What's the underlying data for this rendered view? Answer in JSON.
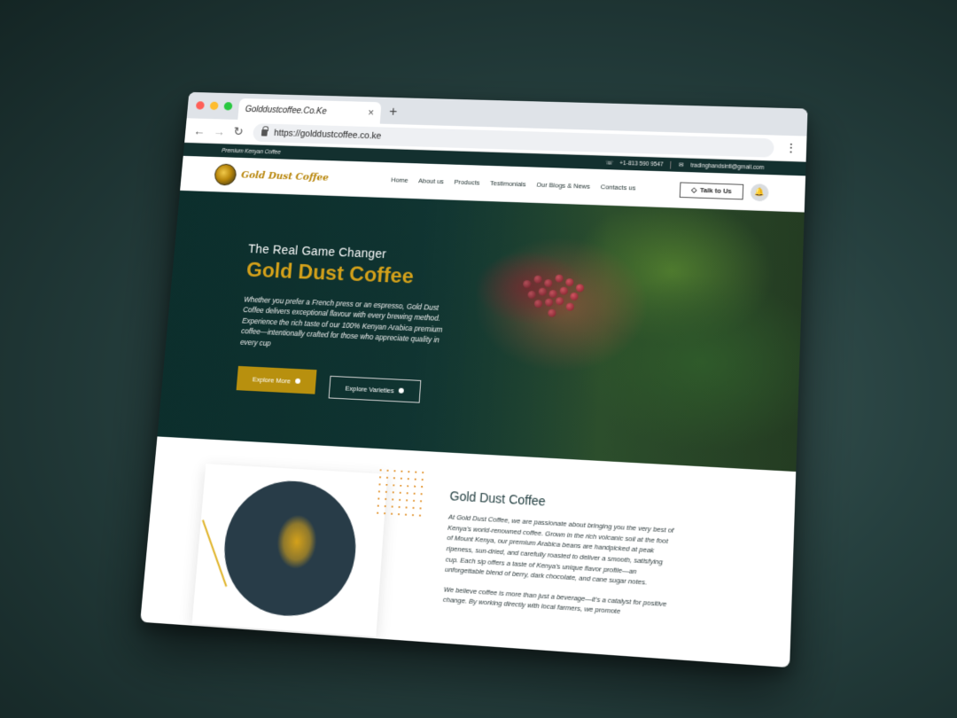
{
  "browser": {
    "tab_title": "Golddustcoffee.Co.Ke",
    "tab_close": "×",
    "new_tab": "+",
    "url": "https://golddustcoffee.co.ke",
    "back": "←",
    "forward": "→",
    "reload": "↻",
    "menu": "⋮"
  },
  "topbar": {
    "tagline": "Premium Kenyan Coffee",
    "phone": "+1-813 590 9547",
    "email": "tradinghandsintl@gmail.com"
  },
  "site_nav": {
    "logo_text": "Gold Dust Coffee",
    "menu": [
      "Home",
      "About us",
      "Products",
      "Testimonials",
      "Our Blogs & News",
      "Contacts us"
    ],
    "talk_button": "Talk to Us",
    "bell_icon": "🔔"
  },
  "hero": {
    "kicker": "The Real Game Changer",
    "title": "Gold Dust Coffee",
    "description": "Whether you prefer a French press or an espresso, Gold Dust Coffee delivers exceptional flavour with every brewing method. Experience the rich taste of our 100% Kenyan Arabica premium coffee—intentionally crafted for those who appreciate quality in every cup",
    "primary_button": "Explore More",
    "secondary_button": "Explore Varieties"
  },
  "about": {
    "title": "Gold Dust Coffee",
    "paragraph1": "At Gold Dust Coffee, we are passionate about bringing you the very best of Kenya's world-renowned coffee. Grown in the rich volcanic soil at the foot of Mount Kenya, our premium Arabica beans are handpicked at peak ripeness, sun-dried, and carefully roasted to deliver a smooth, satisfying cup. Each sip offers a taste of Kenya's unique flavor profile—an unforgettable blend of berry, dark chocolate, and cane sugar notes.",
    "paragraph2": "We believe coffee is more than just a beverage—it's a catalyst for positive change. By working directly with local farmers, we promote"
  }
}
